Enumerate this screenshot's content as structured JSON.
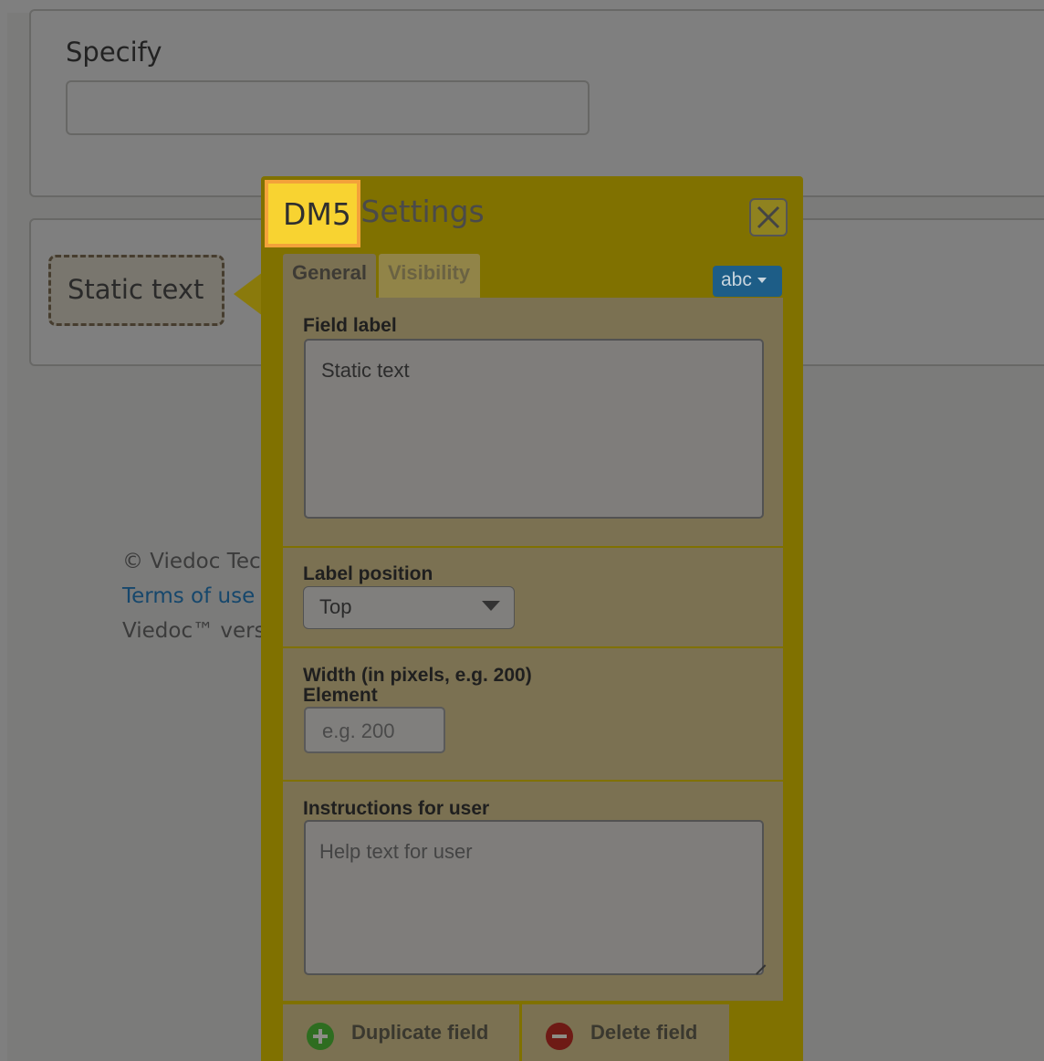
{
  "background": {
    "specify_label": "Specify",
    "static_text_chip": "Static text",
    "footer": {
      "copyright": "© Viedoc Tec",
      "terms_link": "Terms of use",
      "version": "Viedoc™ vers"
    }
  },
  "settings_panel": {
    "title_tag": "DM5",
    "title_rest": "Settings",
    "close_icon": "close-icon",
    "tabs": [
      {
        "label": "General",
        "active": true
      },
      {
        "label": "Visibility",
        "active": false
      }
    ],
    "type_dropdown": "abc",
    "field_label": {
      "label": "Field label",
      "value": "Static text"
    },
    "label_position": {
      "label": "Label position",
      "value": "Top"
    },
    "width": {
      "label_line1": "Width (in pixels, e.g. 200)",
      "label_line2": "Element",
      "placeholder": "e.g. 200"
    },
    "instructions": {
      "label": "Instructions for user",
      "placeholder": "Help text for user"
    },
    "actions": {
      "duplicate": "Duplicate field",
      "delete": "Delete field"
    }
  },
  "colors": {
    "panel_accent": "#807100",
    "highlight_tag": "#f8d331",
    "highlight_border": "#f3a23a",
    "link": "#2d8fd8",
    "dropdown_blue": "#1d5d87"
  }
}
